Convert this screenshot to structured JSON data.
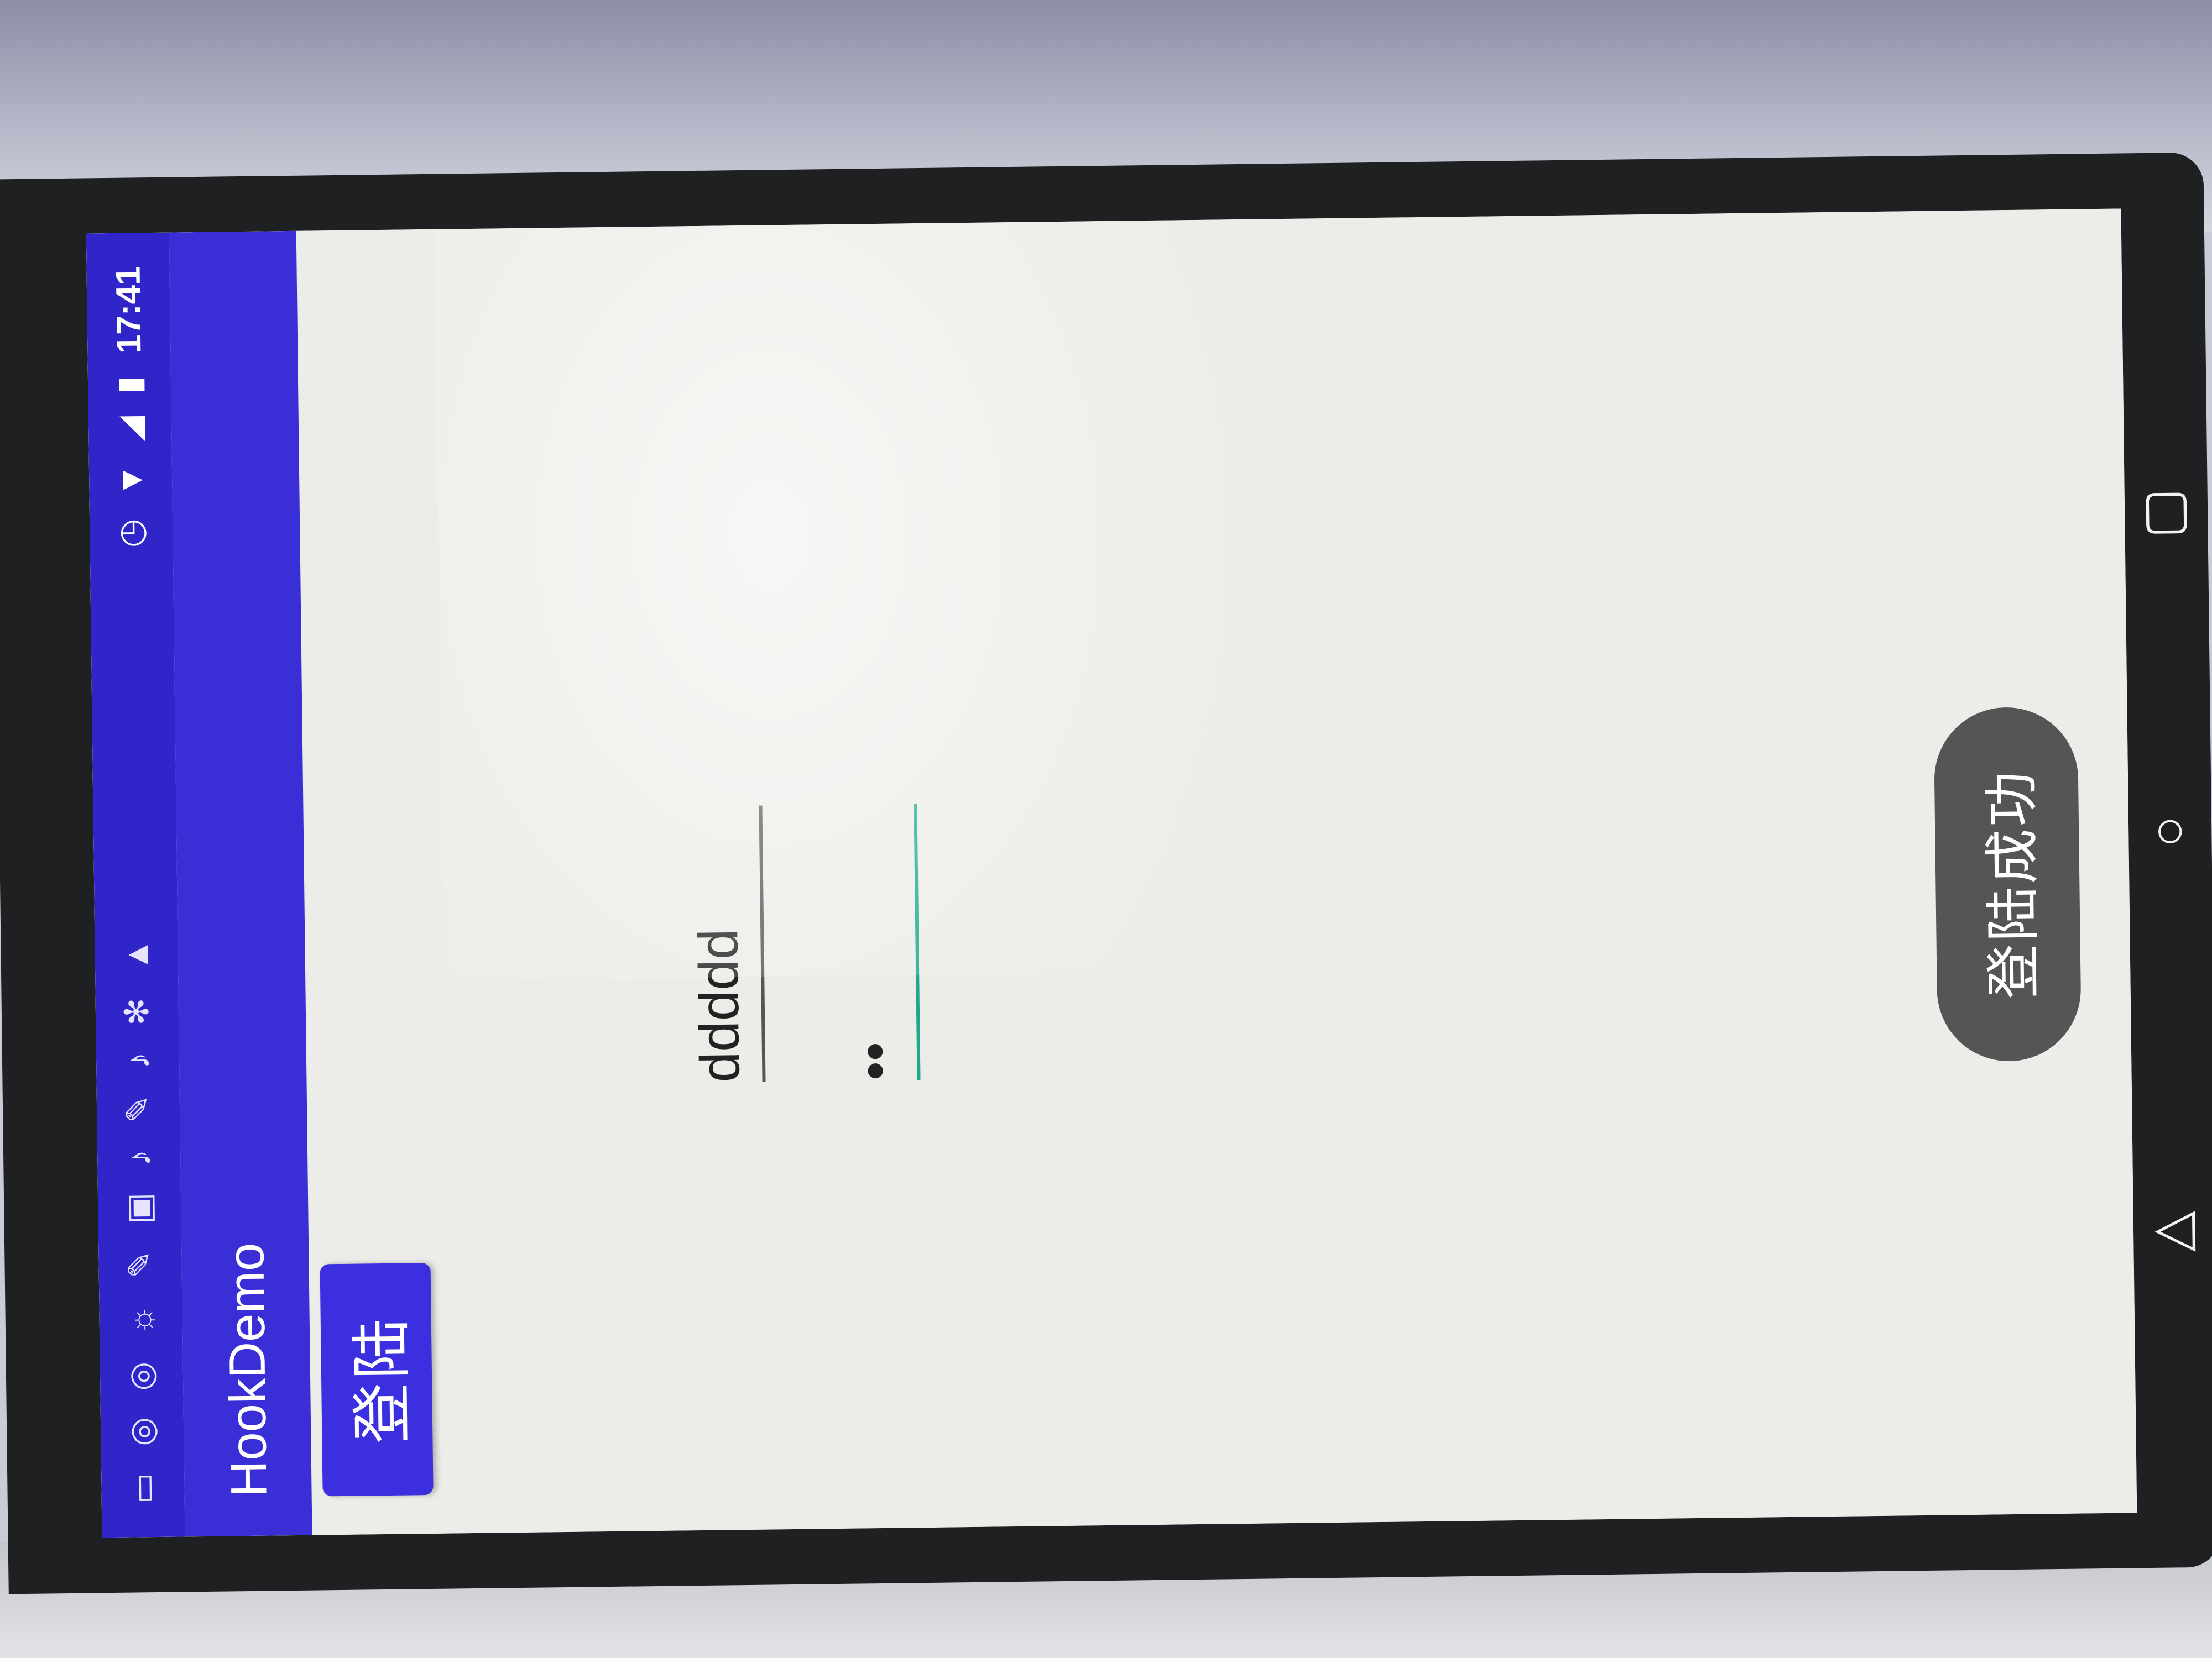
{
  "status_bar": {
    "time": "17:41",
    "icons": [
      "message-icon",
      "sync-icon",
      "sync-icon",
      "brightness-icon",
      "feather-icon",
      "news-icon",
      "tiktok-icon",
      "feather-icon",
      "tiktok-icon",
      "fan-icon",
      "warning-icon",
      "clock-icon",
      "wifi-icon",
      "signal-icon",
      "battery-icon"
    ]
  },
  "toolbar": {
    "title": "HookDemo"
  },
  "form": {
    "login_label": "登陆",
    "username_value": "ddddd",
    "password_value": "••"
  },
  "toast": {
    "message": "登陆成功"
  },
  "colors": {
    "primary": "#3a2fd6",
    "primary_dark": "#2f25c9",
    "accent": "#1fa88e",
    "toast_bg": "#555555"
  }
}
